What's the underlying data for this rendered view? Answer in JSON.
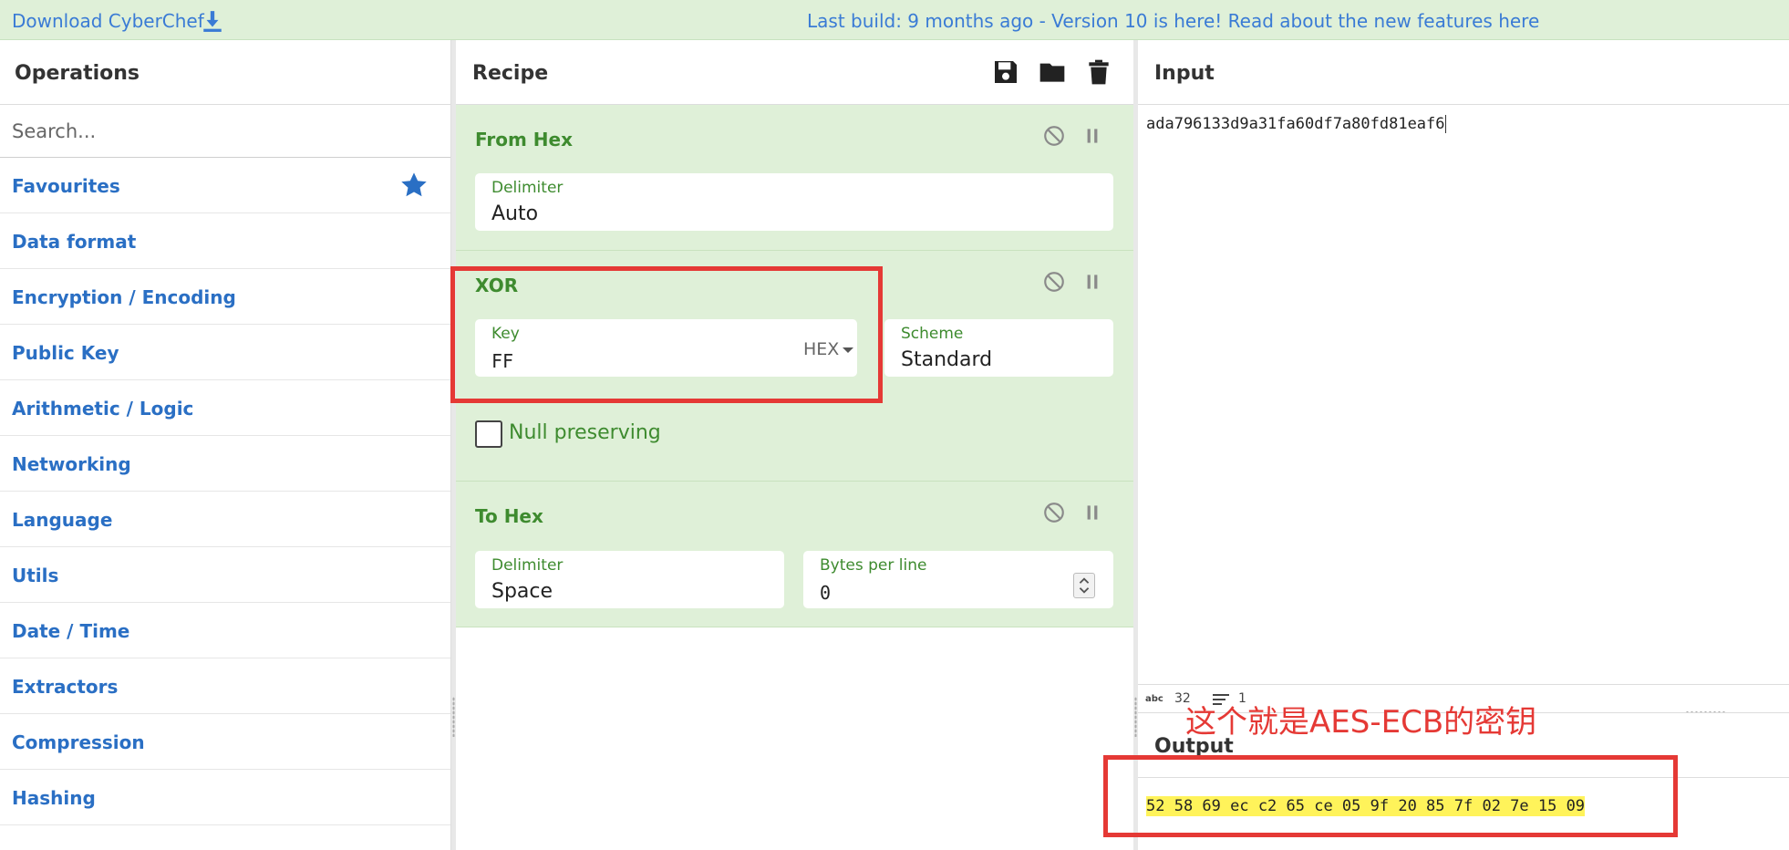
{
  "banner": {
    "download_label": "Download CyberChef",
    "message": "Last build: 9 months ago - Version 10 is here! Read about the new features here"
  },
  "operations": {
    "title": "Operations",
    "search_placeholder": "Search...",
    "categories": [
      {
        "label": "Favourites"
      },
      {
        "label": "Data format"
      },
      {
        "label": "Encryption / Encoding"
      },
      {
        "label": "Public Key"
      },
      {
        "label": "Arithmetic / Logic"
      },
      {
        "label": "Networking"
      },
      {
        "label": "Language"
      },
      {
        "label": "Utils"
      },
      {
        "label": "Date / Time"
      },
      {
        "label": "Extractors"
      },
      {
        "label": "Compression"
      },
      {
        "label": "Hashing"
      }
    ]
  },
  "recipe": {
    "title": "Recipe",
    "ops": [
      {
        "name": "From Hex",
        "fields": [
          {
            "label": "Delimiter",
            "value": "Auto"
          }
        ]
      },
      {
        "name": "XOR",
        "fields": [
          {
            "label": "Key",
            "value": "FF",
            "format": "HEX"
          },
          {
            "label": "Scheme",
            "value": "Standard"
          }
        ],
        "checkbox": {
          "label": "Null preserving",
          "checked": false
        }
      },
      {
        "name": "To Hex",
        "fields": [
          {
            "label": "Delimiter",
            "value": "Space"
          },
          {
            "label": "Bytes per line",
            "value": "0"
          }
        ]
      }
    ]
  },
  "input": {
    "title": "Input",
    "text": "ada796133d9a31fa60df7a80fd81eaf6",
    "status": {
      "abc": "abc",
      "length": "32",
      "lines": "1"
    }
  },
  "output": {
    "title": "Output",
    "text": "52 58 69 ec c2 65 ce 05 9f 20 85 7f 02 7e 15 09"
  },
  "annotation": {
    "text": "这个就是AES-ECB的密钥",
    "color": "#e53935"
  },
  "colors": {
    "accent_green": "#3e8b2f",
    "recipe_bg": "#dff0d8",
    "link_blue": "#2a6fc4",
    "highlight": "#fff35a"
  }
}
